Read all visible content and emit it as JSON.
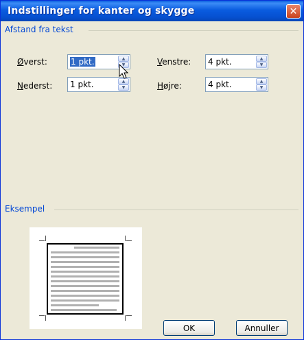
{
  "window": {
    "title": "Indstillinger for kanter og skygge",
    "close_glyph": "✕"
  },
  "distance": {
    "group_label": "Afstand fra tekst",
    "top": {
      "key": "Ø",
      "rest": "verst:",
      "value": "1 pkt."
    },
    "bottom": {
      "key": "N",
      "rest": "ederst:",
      "value": "1 pkt."
    },
    "left": {
      "key": "V",
      "rest": "enstre:",
      "value": "4 pkt."
    },
    "right": {
      "key": "H",
      "rest": "øjre:",
      "value": "4 pkt."
    }
  },
  "preview": {
    "group_label": "Eksempel"
  },
  "buttons": {
    "ok": "OK",
    "cancel": "Annuller"
  },
  "icons": {
    "up": "▲",
    "down": "▼",
    "cursor": "arrow-cursor-icon"
  }
}
